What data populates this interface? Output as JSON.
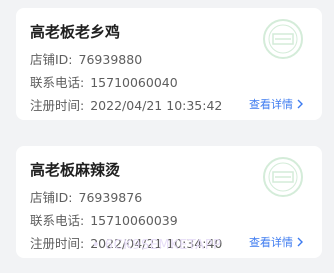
{
  "stores": [
    {
      "name": "高老板老乡鸡",
      "id_label": "店铺ID:",
      "id_value": "76939880",
      "phone_label": "联系电话:",
      "phone_value": "15710060040",
      "time_label": "注册时间:",
      "time_value": "2022/04/21 10:35:42",
      "link_label": "查看详情"
    },
    {
      "name": "高老板麻辣烫",
      "id_label": "店铺ID:",
      "id_value": "76939876",
      "phone_label": "联系电话:",
      "phone_value": "15710060039",
      "time_label": "注册时间:",
      "time_value": "2022/04/21 10:34:40",
      "link_label": "查看详情"
    }
  ],
  "watermark": "• 6CK9SEMKETAPP",
  "colors": {
    "accent": "#3d7bf0",
    "stamp": "#d4ecd9",
    "background": "#f2f3f5"
  },
  "icons": {
    "stamp": "store-stamp-icon",
    "chevron": "chevron-right-icon"
  }
}
